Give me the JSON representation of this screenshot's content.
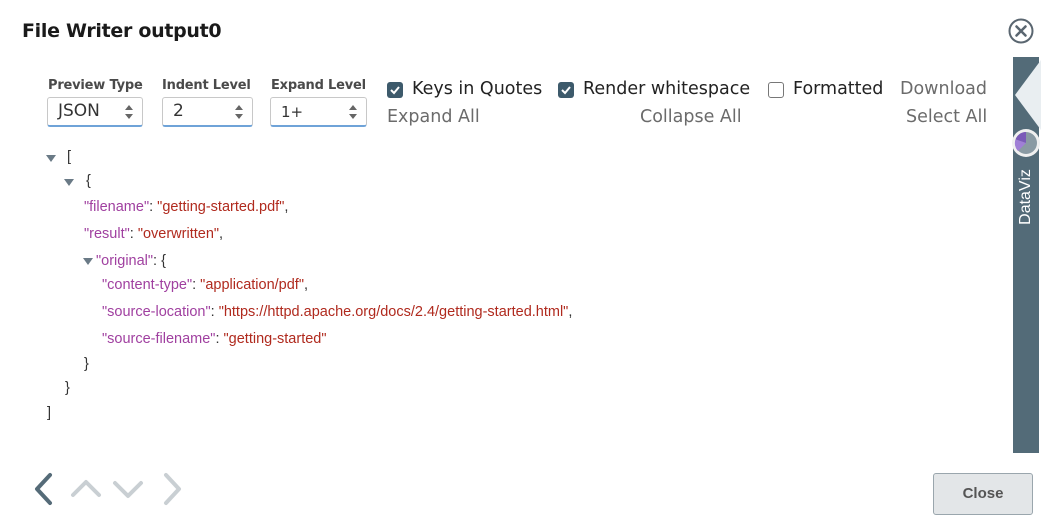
{
  "dialog": {
    "title": "File Writer output0"
  },
  "controls": {
    "preview_type": {
      "label": "Preview Type",
      "value": "JSON"
    },
    "indent_level": {
      "label": "Indent Level",
      "value": "2"
    },
    "expand_level": {
      "label": "Expand Level",
      "value": "1+"
    }
  },
  "options": {
    "keys_in_quotes": {
      "label": "Keys in Quotes",
      "checked": true
    },
    "render_whitespace": {
      "label": "Render whitespace",
      "checked": true
    },
    "formatted": {
      "label": "Formatted",
      "checked": false
    }
  },
  "actions": {
    "download": "Download",
    "expand_all": "Expand All",
    "collapse_all": "Collapse All",
    "select_all": "Select All"
  },
  "json_tree": {
    "open_array": "[",
    "open_object": "{",
    "filename_key": "\"filename\"",
    "filename_value": "\"getting-started.pdf\"",
    "result_key": "\"result\"",
    "result_value": "\"overwritten\"",
    "original_key": "\"original\"",
    "content_type_key": "\"content-type\"",
    "content_type_value": "\"application/pdf\"",
    "source_location_key": "\"source-location\"",
    "source_location_value": "\"https://httpd.apache.org/docs/2.4/getting-started.html\"",
    "source_filename_key": "\"source-filename\"",
    "source_filename_value": "\"getting-started\"",
    "close_inner": "}",
    "close_object": "}",
    "close_array": "]"
  },
  "sidebar": {
    "dataviz_label": "DataViz"
  },
  "footer": {
    "close_label": "Close"
  },
  "colors": {
    "key": "#a040a0",
    "string": "#b02a1e",
    "sidebar": "#536b78",
    "accent": "#6fa3d8"
  }
}
